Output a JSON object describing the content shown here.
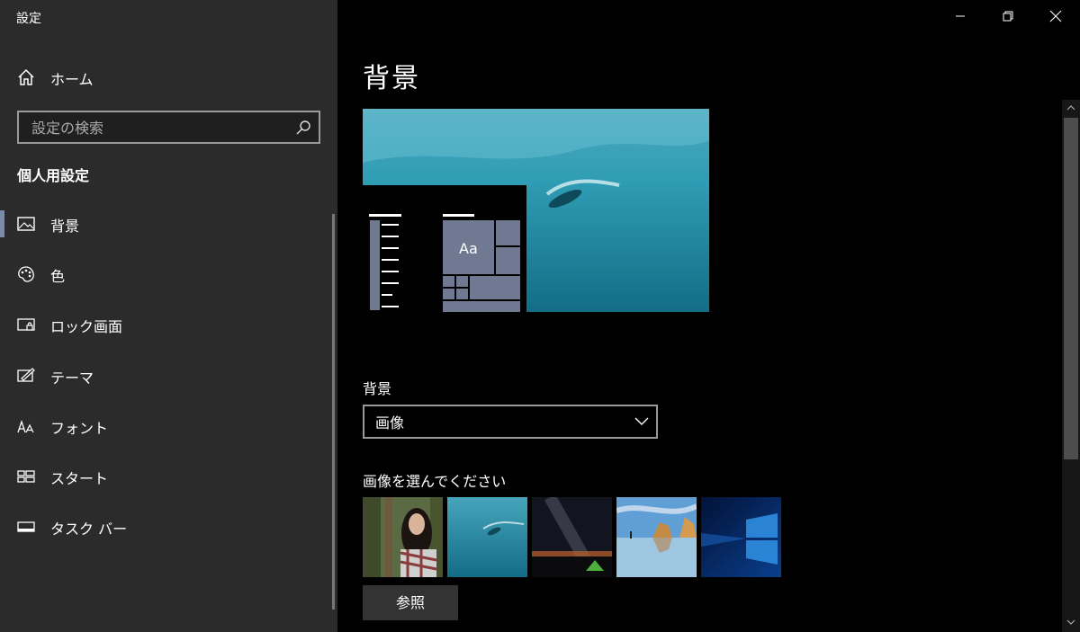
{
  "window": {
    "title": "設定",
    "controls": [
      "minimize-icon",
      "restore-icon",
      "close-icon"
    ]
  },
  "sidebar": {
    "home_label": "ホーム",
    "search_placeholder": "設定の検索",
    "section_title": "個人用設定",
    "items": [
      {
        "label": "背景",
        "icon": "picture-icon",
        "active": true
      },
      {
        "label": "色",
        "icon": "palette-icon",
        "active": false
      },
      {
        "label": "ロック画面",
        "icon": "lock-screen-icon",
        "active": false
      },
      {
        "label": "テーマ",
        "icon": "theme-icon",
        "active": false
      },
      {
        "label": "フォント",
        "icon": "font-icon",
        "active": false
      },
      {
        "label": "スタート",
        "icon": "start-icon",
        "active": false
      },
      {
        "label": "タスク バー",
        "icon": "taskbar-icon",
        "active": false
      }
    ],
    "accent": "#7a8aa8"
  },
  "main": {
    "title": "背景",
    "preview": {
      "tile_text": "Aa"
    },
    "background_label": "背景",
    "background_value": "画像",
    "choose_label": "画像を選んでください",
    "thumbnails": [
      "forest-portrait",
      "underwater-swimmer",
      "milky-way-camp",
      "beach-rocks",
      "windows-logo"
    ],
    "browse_label": "参照"
  }
}
